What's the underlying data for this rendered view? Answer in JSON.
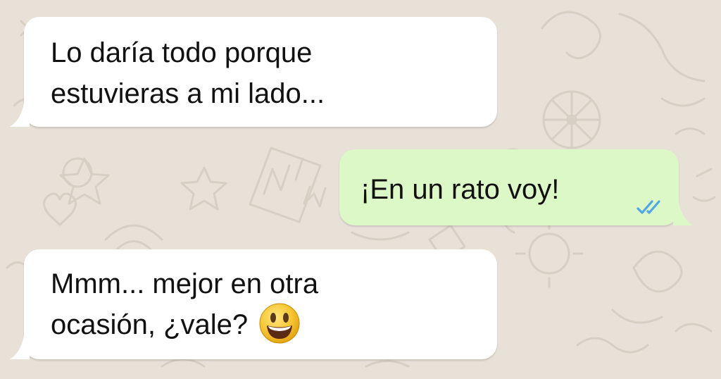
{
  "theme": {
    "wallpaper": "#e7e1d8",
    "doodle": "#d8d1c6",
    "incoming_bubble": "#ffffff",
    "outgoing_bubble": "#dcf8c6",
    "read_ticks": "#4fa6e8"
  },
  "messages": [
    {
      "direction": "incoming",
      "lines": [
        "Lo daría todo porque",
        "estuvieras a mi lado..."
      ]
    },
    {
      "direction": "outgoing",
      "text": "¡En un rato voy!",
      "status_icon": "double-check-read-icon"
    },
    {
      "direction": "incoming",
      "lines": [
        "Mmm... mejor en otra",
        "ocasión, ¿vale?"
      ],
      "emoji": "grinning-face-emoji"
    }
  ]
}
